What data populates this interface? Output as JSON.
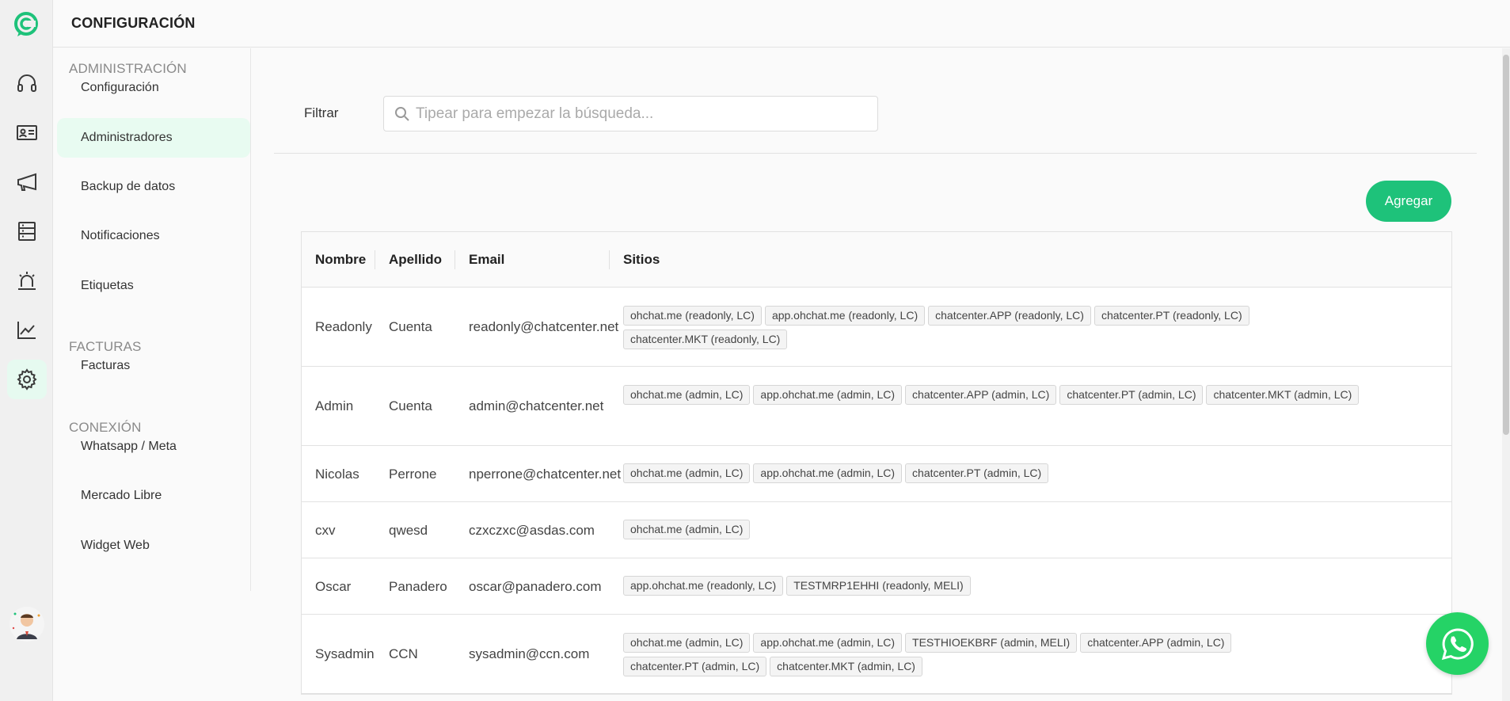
{
  "app": {
    "title": "CONFIGURACIÓN"
  },
  "colors": {
    "accent": "#1ec27a",
    "active_bg": "#e8fbf1",
    "whatsapp": "#25d366"
  },
  "rail": {
    "icons": [
      "headset-icon",
      "contact-card-icon",
      "megaphone-icon",
      "server-icon",
      "alarm-icon",
      "chart-line-icon",
      "gear-icon"
    ],
    "active": "gear-icon"
  },
  "subnav": {
    "sections": [
      {
        "title": "ADMINISTRACIÓN",
        "items": [
          "Configuración",
          "Administradores",
          "Backup de datos",
          "Notificaciones",
          "Etiquetas"
        ]
      },
      {
        "title": "FACTURAS",
        "items": [
          "Facturas"
        ]
      },
      {
        "title": "CONEXIÓN",
        "items": [
          "Whatsapp / Meta",
          "Mercado Libre",
          "Widget Web"
        ]
      }
    ],
    "active_item": "Administradores"
  },
  "filter": {
    "label": "Filtrar",
    "placeholder": "Tipear para empezar la búsqueda..."
  },
  "add_button": "Agregar",
  "table": {
    "headers": [
      "Nombre",
      "Apellido",
      "Email",
      "Sitios"
    ],
    "rows": [
      {
        "nombre": "Readonly",
        "apellido": "Cuenta",
        "email": "readonly@chatcenter.net",
        "sitios": [
          "ohchat.me (readonly, LC)",
          "app.ohchat.me (readonly, LC)",
          "chatcenter.APP (readonly, LC)",
          "chatcenter.PT (readonly, LC)",
          "chatcenter.MKT (readonly, LC)"
        ]
      },
      {
        "nombre": "Admin",
        "apellido": "Cuenta",
        "email": "admin@chatcenter.net",
        "sitios": [
          "ohchat.me (admin, LC)",
          "app.ohchat.me (admin, LC)",
          "chatcenter.APP (admin, LC)",
          "chatcenter.PT (admin, LC)",
          "chatcenter.MKT (admin, LC)"
        ]
      },
      {
        "nombre": "Nicolas",
        "apellido": "Perrone",
        "email": "nperrone@chatcenter.net",
        "sitios": [
          "ohchat.me (admin, LC)",
          "app.ohchat.me (admin, LC)",
          "chatcenter.PT (admin, LC)"
        ]
      },
      {
        "nombre": "cxv",
        "apellido": "qwesd",
        "email": "czxczxc@asdas.com",
        "sitios": [
          "ohchat.me (admin, LC)"
        ]
      },
      {
        "nombre": "Oscar",
        "apellido": "Panadero",
        "email": "oscar@panadero.com",
        "sitios": [
          "app.ohchat.me (readonly, LC)",
          "TESTMRP1EHHI (readonly, MELI)"
        ]
      },
      {
        "nombre": "Sysadmin",
        "apellido": "CCN",
        "email": "sysadmin@ccn.com",
        "sitios": [
          "ohchat.me (admin, LC)",
          "app.ohchat.me (admin, LC)",
          "TESTHIOEKBRF (admin, MELI)",
          "chatcenter.APP (admin, LC)",
          "chatcenter.PT (admin, LC)",
          "chatcenter.MKT (admin, LC)"
        ]
      }
    ]
  }
}
